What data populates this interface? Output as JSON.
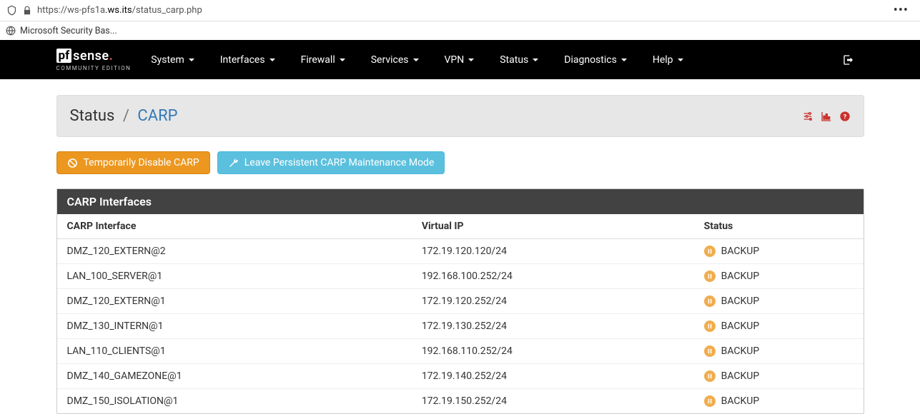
{
  "browser": {
    "url_prefix": "https://ws-pfs1a",
    "url_domain": ".ws.its",
    "url_path": "/status_carp.php",
    "bookmark": "Microsoft Security Bas..."
  },
  "logo": {
    "pf": "pf",
    "sense": "sense",
    "sub": "COMMUNITY EDITION"
  },
  "nav": [
    {
      "label": "System"
    },
    {
      "label": "Interfaces"
    },
    {
      "label": "Firewall"
    },
    {
      "label": "Services"
    },
    {
      "label": "VPN"
    },
    {
      "label": "Status"
    },
    {
      "label": "Diagnostics"
    },
    {
      "label": "Help"
    }
  ],
  "breadcrumb": {
    "root": "Status",
    "current": "CARP"
  },
  "buttons": {
    "disable": "Temporarily Disable CARP",
    "leave": "Leave Persistent CARP Maintenance Mode"
  },
  "panel": {
    "title": "CARP Interfaces",
    "columns": {
      "iface": "CARP Interface",
      "vip": "Virtual IP",
      "status": "Status"
    },
    "rows": [
      {
        "iface": "DMZ_120_EXTERN@2",
        "vip": "172.19.120.120/24",
        "status": "BACKUP"
      },
      {
        "iface": "LAN_100_SERVER@1",
        "vip": "192.168.100.252/24",
        "status": "BACKUP"
      },
      {
        "iface": "DMZ_120_EXTERN@1",
        "vip": "172.19.120.252/24",
        "status": "BACKUP"
      },
      {
        "iface": "DMZ_130_INTERN@1",
        "vip": "172.19.130.252/24",
        "status": "BACKUP"
      },
      {
        "iface": "LAN_110_CLIENTS@1",
        "vip": "192.168.110.252/24",
        "status": "BACKUP"
      },
      {
        "iface": "DMZ_140_GAMEZONE@1",
        "vip": "172.19.140.252/24",
        "status": "BACKUP"
      },
      {
        "iface": "DMZ_150_ISOLATION@1",
        "vip": "172.19.150.252/24",
        "status": "BACKUP"
      }
    ]
  }
}
